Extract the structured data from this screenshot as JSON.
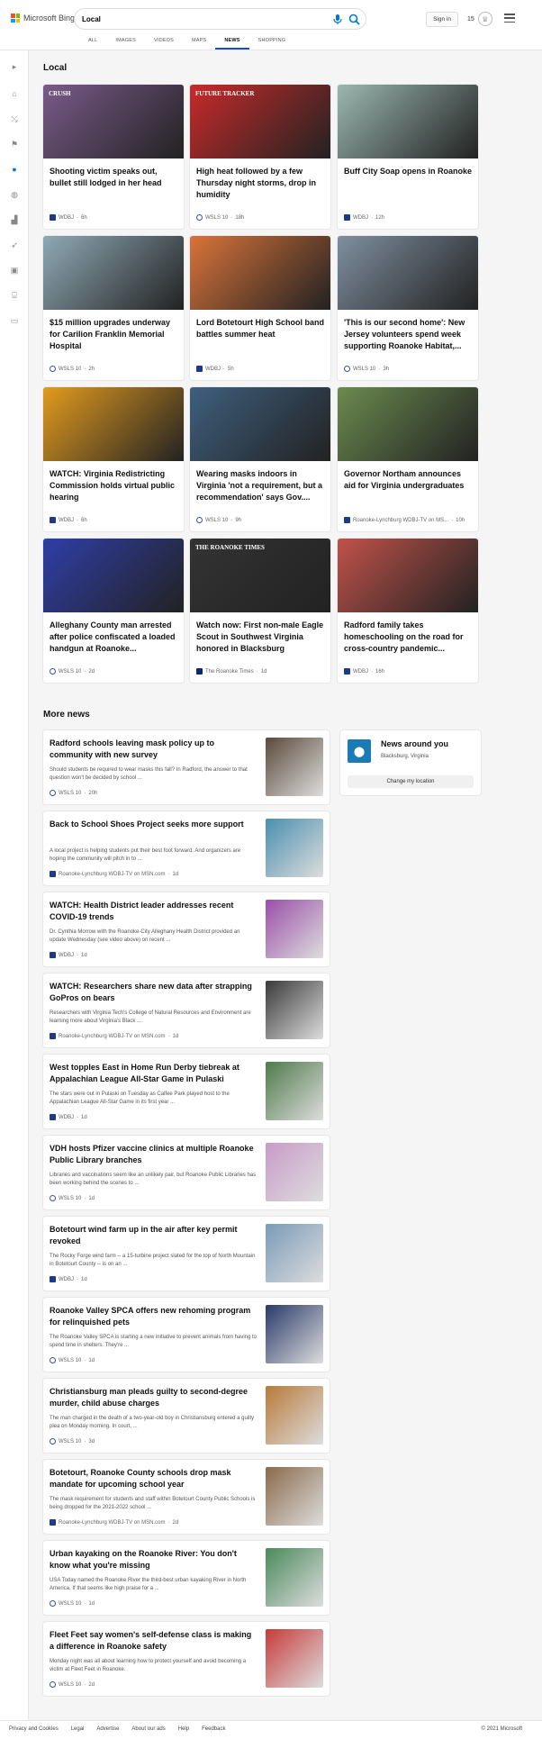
{
  "header": {
    "brand": "Microsoft Bing",
    "search_value": "Local",
    "signin_label": "Sign in",
    "rewards_count": "15",
    "tabs": [
      "ALL",
      "IMAGES",
      "VIDEOS",
      "MAPS",
      "NEWS",
      "SHOPPING"
    ],
    "active_tab": "NEWS"
  },
  "local": {
    "title": "Local",
    "cards": [
      {
        "title": "Shooting victim speaks out, bullet still lodged in her head",
        "source": "WDBJ",
        "time": "6h",
        "img_text": "CRUSH",
        "color": "#7a5a8a"
      },
      {
        "title": "High heat followed by a few Thursday night storms, drop in humidity",
        "source": "WSLS 10",
        "time": "18h",
        "img_text": "FUTURE TRACKER",
        "color": "#c92a2a"
      },
      {
        "title": "Buff City Soap opens in Roanoke",
        "source": "WDBJ",
        "time": "12h",
        "img_text": "",
        "color": "#9bb7b0"
      },
      {
        "title": "$15 million upgrades underway for Carilion Franklin Memorial Hospital",
        "source": "WSLS 10",
        "time": "2h",
        "img_text": "",
        "color": "#8fa9b5"
      },
      {
        "title": "Lord Botetourt High School band battles summer heat",
        "source": "WDBJ",
        "time": "5h",
        "img_text": "",
        "color": "#d9733a"
      },
      {
        "title": "'This is our second home': New Jersey volunteers spend week supporting Roanoke Habitat,...",
        "source": "WSLS 10",
        "time": "3h",
        "img_text": "",
        "color": "#7f8fa0"
      },
      {
        "title": "WATCH: Virginia Redistricting Commission holds virtual public hearing",
        "source": "WDBJ",
        "time": "6h",
        "img_text": "",
        "color": "#e39b1e"
      },
      {
        "title": "Wearing masks indoors in Virginia 'not a requirement, but a recommendation' says Gov....",
        "source": "WSLS 10",
        "time": "9h",
        "img_text": "",
        "color": "#3e5f7e"
      },
      {
        "title": "Governor Northam announces aid for Virginia undergraduates",
        "source": "Roanoke-Lynchburg WDBJ-TV on MS...",
        "time": "10h",
        "img_text": "",
        "color": "#6b8a4f"
      },
      {
        "title": "Alleghany County man arrested after police confiscated a loaded handgun at Roanoke...",
        "source": "WSLS 10",
        "time": "2d",
        "img_text": "",
        "color": "#2f3ea8"
      },
      {
        "title": "Watch now: First non-male Eagle Scout in Southwest Virginia honored in Blacksburg",
        "source": "The Roanoke Times",
        "time": "1d",
        "img_text": "THE ROANOKE TIMES",
        "color": "#333333"
      },
      {
        "title": "Radford family takes homeschooling on the road for cross-country pandemic...",
        "source": "WDBJ",
        "time": "16h",
        "img_text": "",
        "color": "#c0524a"
      }
    ]
  },
  "more_news": {
    "title": "More news",
    "items": [
      {
        "title": "Radford schools leaving mask policy up to community with new survey",
        "desc": "Should students be required to wear masks this fall? In Radford, the answer to that question won't be decided by school ...",
        "source": "WSLS 10",
        "time": "20h",
        "color": "#5a4a3a"
      },
      {
        "title": "Back to School Shoes Project seeks more support",
        "desc": "A local project is helping students put their best foot forward. And organizers are hoping the community will pitch in to ...",
        "source": "Roanoke-Lynchburg WDBJ-TV on MSN.com",
        "time": "1d",
        "color": "#4a8fb0"
      },
      {
        "title": "WATCH: Health District leader addresses recent COVID-19 trends",
        "desc": "Dr. Cynthia Morrow with the Roanoke-City Alleghany Health District provided an update Wednesday (see video above) on recent ...",
        "source": "WDBJ",
        "time": "1d",
        "color": "#9a4fa8"
      },
      {
        "title": "WATCH: Researchers share new data after strapping GoPros on bears",
        "desc": "Researchers with Virginia Tech's College of Natural Resources and Environment are learning more about Virginia's Black ...",
        "source": "Roanoke-Lynchburg WDBJ-TV on MSN.com",
        "time": "1d",
        "color": "#3a3a3a"
      },
      {
        "title": "West topples East in Home Run Derby tiebreak at Appalachian League All-Star Game in Pulaski",
        "desc": "The stars were out in Pulaski on Tuesday as Calfee Park played host to the Appalachian League All-Star Game in its first year ...",
        "source": "WDBJ",
        "time": "1d",
        "color": "#4e7a4a"
      },
      {
        "title": "VDH hosts Pfizer vaccine clinics at multiple Roanoke Public Library branches",
        "desc": "Libraries and vaccinations seem like an unlikely pair, but Roanoke Public Libraries has been working behind the scenes to ...",
        "source": "WSLS 10",
        "time": "1d",
        "color": "#c89bc8"
      },
      {
        "title": "Botetourt wind farm up in the air after key permit revoked",
        "desc": "The Rocky Forge wind farm -- a 15-turbine project slated for the top of North Mountain in Botetourt County -- is on an ...",
        "source": "WDBJ",
        "time": "1d",
        "color": "#7a9bb8"
      },
      {
        "title": "Roanoke Valley SPCA offers new rehoming program for relinquished pets",
        "desc": "The Roanoke Valley SPCA is starting a new initiative to prevent animals from having to spend time in shelters. They're ...",
        "source": "WSLS 10",
        "time": "1d",
        "color": "#2a3a6a"
      },
      {
        "title": "Christiansburg man pleads guilty to second-degree murder, child abuse charges",
        "desc": "The man charged in the death of a two-year-old boy in Christiansburg entered a guilty plea on Monday morning. In court, ...",
        "source": "WSLS 10",
        "time": "3d",
        "color": "#b87a3a"
      },
      {
        "title": "Botetourt, Roanoke County schools drop mask mandate for upcoming school year",
        "desc": "The mask requirement for students and staff within Botetourt County Public Schools is being dropped for the 2021-2022 school ...",
        "source": "Roanoke-Lynchburg WDBJ-TV on MSN.com",
        "time": "2d",
        "color": "#8a6a4a"
      },
      {
        "title": "Urban kayaking on the Roanoke River: You don't know what you're missing",
        "desc": "USA Today named the Roanoke River the third-best urban kayaking River in North America. If that seems like high praise for a ...",
        "source": "WSLS 10",
        "time": "1d",
        "color": "#4a8a5a"
      },
      {
        "title": "Fleet Feet say women's self-defense class is making a difference in Roanoke safety",
        "desc": "Monday night was all about learning how to protect yourself and avoid becoming a victim at Fleet Feet in Roanoke.",
        "source": "WSLS 10",
        "time": "2d",
        "color": "#c83a3a"
      }
    ]
  },
  "around_you": {
    "title": "News around you",
    "location": "Blacksburg, Virginia",
    "button": "Change my location"
  },
  "footer": {
    "links": [
      "Privacy and Cookies",
      "Legal",
      "Advertise",
      "About our ads",
      "Help",
      "Feedback"
    ],
    "copyright": "© 2021 Microsoft"
  }
}
